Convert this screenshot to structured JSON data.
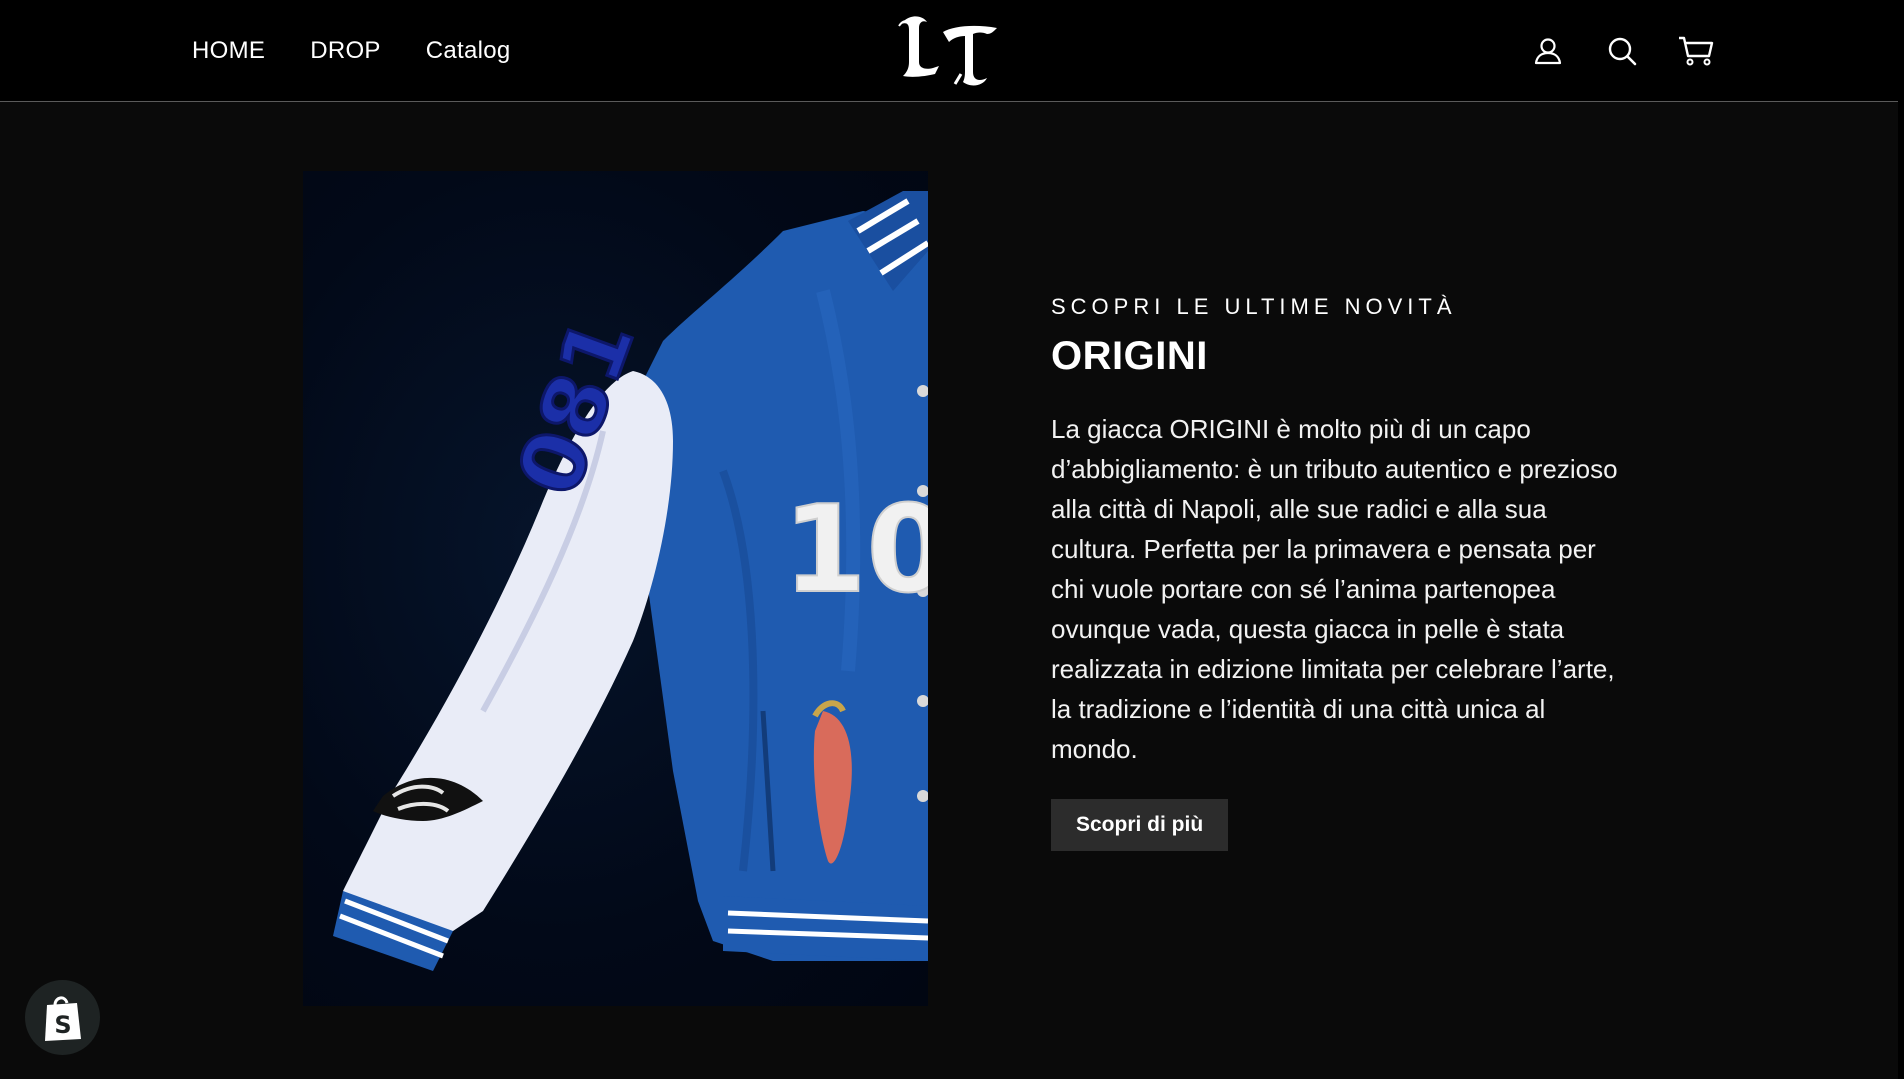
{
  "nav": {
    "items": [
      {
        "label": "HOME"
      },
      {
        "label": "DROP"
      },
      {
        "label": "Catalog"
      }
    ]
  },
  "header": {
    "logo_alt": "LT",
    "icons": [
      "account-icon",
      "search-icon",
      "cart-icon"
    ]
  },
  "hero": {
    "subtitle": "SCOPRI LE ULTIME NOVITÀ",
    "title": "ORIGINI",
    "description": "La giacca ORIGINI è molto più di un capo d’abbigliamento: è un tributo autentico e prezioso alla città di Napoli, alle sue radici e alla sua cultura. Perfetta per la primavera e pensata per chi vuole portare con sé l’anima partenopea ovunque vada, questa giacca in pelle è stata realizzata in edizione limitata per celebrare l’arte, la tradizione e l’identità di una città unica al mondo.",
    "cta_label": "Scopri di più",
    "image_alt": "Giacca ORIGINI"
  },
  "badge": {
    "icon": "shopify-bag-icon"
  },
  "colors": {
    "header_bg": "#000000",
    "page_bg": "#0a0a0a",
    "button_bg": "#2c2c2c",
    "jacket_blue": "#1f5bb0",
    "sleeve_white": "#e9ecf7"
  }
}
